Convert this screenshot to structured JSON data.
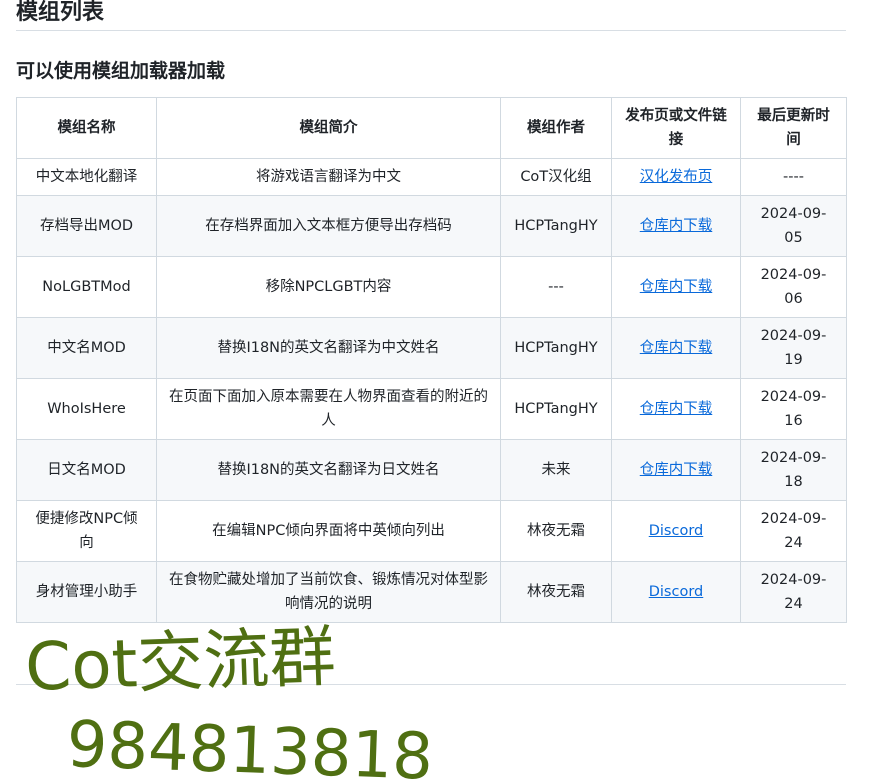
{
  "page": {
    "title": "模组列表",
    "section_title": "可以使用模组加载器加载"
  },
  "table": {
    "headers": [
      "模组名称",
      "模组简介",
      "模组作者",
      "发布页或文件链接",
      "最后更新时间"
    ],
    "rows": [
      {
        "name": "中文本地化翻译",
        "desc": "将游戏语言翻译为中文",
        "author": "CoT汉化组",
        "link": "汉化发布页",
        "date": "----"
      },
      {
        "name": "存档导出MOD",
        "desc": "在存档界面加入文本框方便导出存档码",
        "author": "HCPTangHY",
        "link": "仓库内下载",
        "date": "2024-09-05"
      },
      {
        "name": "NoLGBTMod",
        "desc": "移除NPCLGBT内容",
        "author": "---",
        "link": "仓库内下载",
        "date": "2024-09-06"
      },
      {
        "name": "中文名MOD",
        "desc": "替换I18N的英文名翻译为中文姓名",
        "author": "HCPTangHY",
        "link": "仓库内下载",
        "date": "2024-09-19"
      },
      {
        "name": "WhoIsHere",
        "desc": "在页面下面加入原本需要在人物界面查看的附近的人",
        "author": "HCPTangHY",
        "link": "仓库内下载",
        "date": "2024-09-16"
      },
      {
        "name": "日文名MOD",
        "desc": "替换I18N的英文名翻译为日文姓名",
        "author": "未来",
        "link": "仓库内下载",
        "date": "2024-09-18"
      },
      {
        "name": "便捷修改NPC倾向",
        "desc": "在编辑NPC倾向界面将中英倾向列出",
        "author": "林夜无霜",
        "link": "Discord",
        "date": "2024-09-24"
      },
      {
        "name": "身材管理小助手",
        "desc": "在食物贮藏处增加了当前饮食、锻炼情况对体型影响情况的说明",
        "author": "林夜无霜",
        "link": "Discord",
        "date": "2024-09-24"
      }
    ]
  },
  "overlay": {
    "handwriting_line1": "Cot交流群",
    "handwriting_line2": "984813818",
    "ink_color": "#4f6f12"
  }
}
